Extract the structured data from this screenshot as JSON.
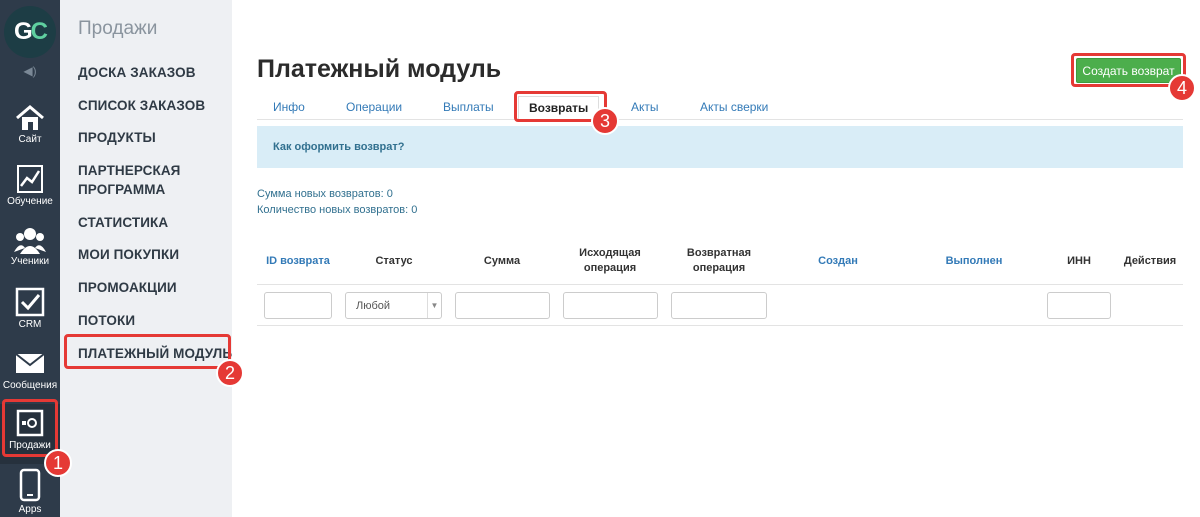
{
  "rail": {
    "logo_g": "G",
    "logo_c": "C",
    "items": [
      {
        "label": "Сайт",
        "icon": "home-icon"
      },
      {
        "label": "Обучение",
        "icon": "chart-icon"
      },
      {
        "label": "Ученики",
        "icon": "users-icon"
      },
      {
        "label": "CRM",
        "icon": "checkbox-icon"
      },
      {
        "label": "Сообщения",
        "icon": "envelope-icon"
      },
      {
        "label": "Продажи",
        "icon": "safe-icon"
      },
      {
        "label": "Apps",
        "icon": "phone-icon"
      }
    ]
  },
  "submenu": {
    "title": "Продажи",
    "items": [
      "ДОСКА ЗАКАЗОВ",
      "СПИСОК ЗАКАЗОВ",
      "ПРОДУКТЫ",
      "ПАРТНЕРСКАЯ ПРОГРАММА",
      "СТАТИСТИКА",
      "МОИ ПОКУПКИ",
      "ПРОМОАКЦИИ",
      "ПОТОКИ",
      "ПЛАТЕЖНЫЙ МОДУЛЬ"
    ]
  },
  "main": {
    "title": "Платежный модуль",
    "create_button": "Создать возврат",
    "tabs": [
      "Инфо",
      "Операции",
      "Выплаты",
      "Возвраты",
      "Акты",
      "Акты сверки"
    ],
    "info_link": "Как оформить возврат?",
    "sum_new": "Сумма новых возвратов: 0",
    "count_new": "Количество новых возвратов: 0"
  },
  "table": {
    "headers": {
      "id": "ID возврата",
      "status": "Статус",
      "sum": "Сумма",
      "out_op_1": "Исходящая",
      "out_op_2": "операция",
      "ret_op_1": "Возвратная",
      "ret_op_2": "операция",
      "created": "Создан",
      "done": "Выполнен",
      "inn": "ИНН",
      "actions": "Действия"
    },
    "status_filter": "Любой"
  },
  "annotations": {
    "b1": "1",
    "b2": "2",
    "b3": "3",
    "b4": "4"
  },
  "colors": {
    "rail": "#2e3b4a",
    "highlight": "#e53935",
    "accent_green": "#4cae4c",
    "link": "#337ab7"
  }
}
